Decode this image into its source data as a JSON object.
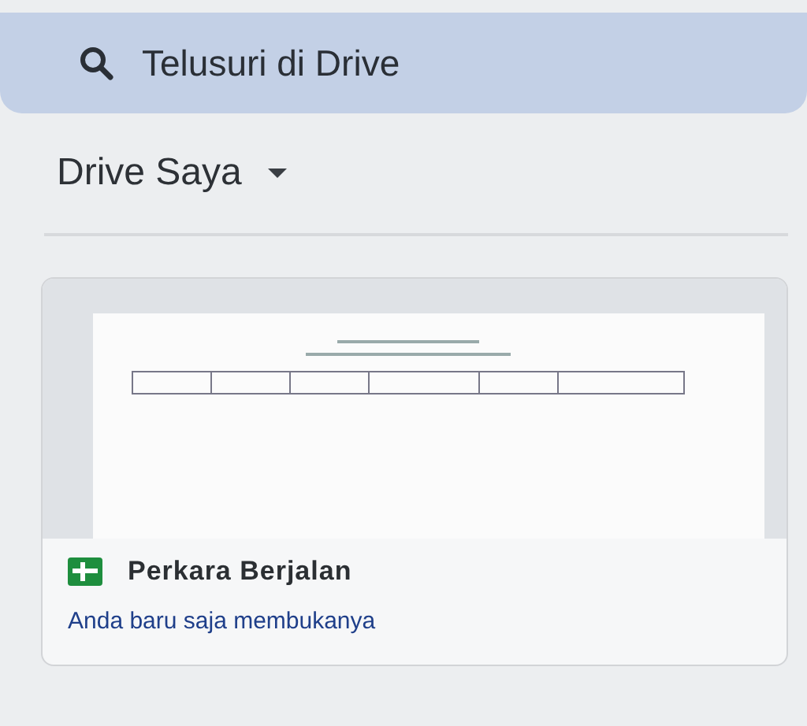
{
  "search": {
    "placeholder": "Telusuri di Drive"
  },
  "header": {
    "title": "Drive Saya"
  },
  "files": [
    {
      "name": "Perkara Berjalan",
      "subtitle": "Anda baru saja membukanya"
    }
  ]
}
